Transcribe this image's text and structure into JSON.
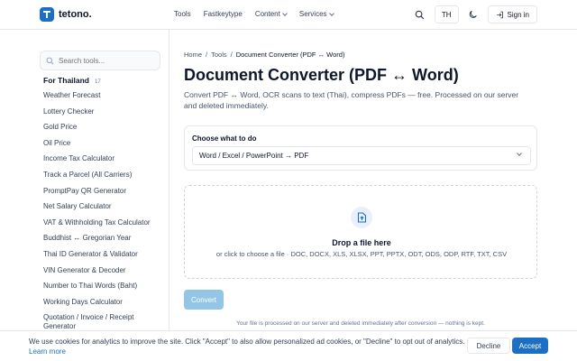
{
  "header": {
    "brand": "tetono.",
    "nav": [
      {
        "label": "Tools",
        "dropdown": false
      },
      {
        "label": "Fastkeytype",
        "dropdown": false
      },
      {
        "label": "Content",
        "dropdown": true
      },
      {
        "label": "Services",
        "dropdown": true
      }
    ],
    "lang": "TH",
    "signin": "Sign in"
  },
  "sidebar": {
    "search_placeholder": "Search tools...",
    "section": "For Thailand",
    "count": "17",
    "items": [
      "Weather Forecast",
      "Lottery Checker",
      "Gold Price",
      "Oil Price",
      "Income Tax Calculator",
      "Track a Parcel (All Carriers)",
      "PromptPay QR Generator",
      "Net Salary Calculator",
      "VAT & Withholding Tax Calculator",
      "Buddhist ↔ Gregorian Year",
      "Thai ID Generator & Validator",
      "VIN Generator & Decoder",
      "Number to Thai Words (Baht)",
      "Working Days Calculator",
      "Quotation / Invoice / Receipt Generator"
    ]
  },
  "main": {
    "breadcrumb": [
      "Home",
      "Tools",
      "Document Converter (PDF ↔ Word)"
    ],
    "title": "Document Converter (PDF ↔ Word)",
    "description": "Convert PDF ↔ Word, OCR scans to text (Thai), compress PDFs — free. Processed on our server and deleted immediately.",
    "choose_label": "Choose what to do",
    "select_value": "Word / Excel / PowerPoint → PDF",
    "drop_title": "Drop a file here",
    "drop_sub": "or click to choose a file · DOC, DOCX, XLS, XLSX, PPT, PPTX, ODT, ODS, ODP, RTF, TXT, CSV",
    "convert": "Convert",
    "note": "Your file is processed on our server and deleted immediately after conversion — nothing is kept."
  },
  "cookie": {
    "text": "We use cookies for analytics to improve the site. Click \"Accept\" to also allow personalized ad cookies, or \"Decline\" to opt out of analytics.",
    "learn_more": "Learn more",
    "decline": "Decline",
    "accept": "Accept"
  },
  "colors": {
    "brand": "#1d6fc4",
    "convert_disabled": "#93c5e6"
  }
}
